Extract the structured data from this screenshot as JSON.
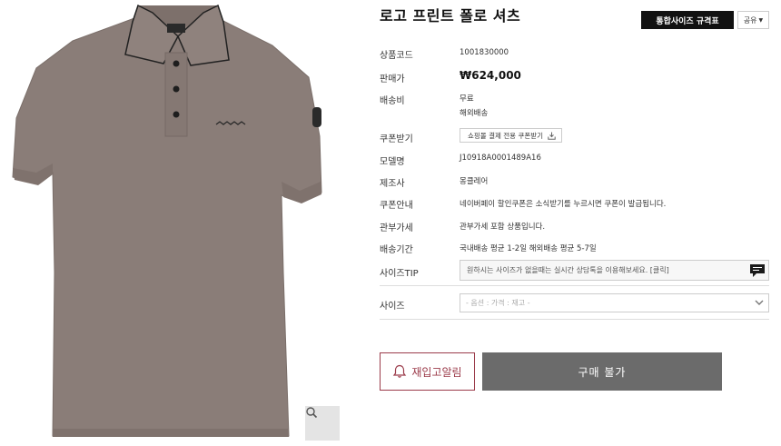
{
  "product": {
    "title": "로고 프린트 폴로 셔츠",
    "image_icon": "polo-shirt-image",
    "shirt_color": "#8a7d78"
  },
  "header": {
    "size_chart_label": "통합사이즈 규격표",
    "share_label": "공유"
  },
  "details": {
    "product_code_label": "상품코드",
    "product_code": "1001830000",
    "price_label": "판매가",
    "price": "₩624,000",
    "shipping_label": "배송비",
    "shipping_fee": "무료",
    "shipping_type": "해외배송",
    "coupon_label": "쿠폰받기",
    "coupon_button": "쇼핑몰 결제 전용 쿠폰받기",
    "model_label": "모델명",
    "model": "J10918A0001489A16",
    "maker_label": "제조사",
    "maker": "몽클레어",
    "coupon_info_label": "쿠폰안내",
    "coupon_info": "네이버페이 할인쿠폰은 소식받기를 누르시면 쿠폰이 발급됩니다.",
    "customs_label": "관부가세",
    "customs": "관부가세 포함 상품입니다.",
    "delivery_label": "배송기간",
    "delivery": "국내배송 평균 1-2일 해외배송 평균 5-7일",
    "size_tip_label": "사이즈TIP",
    "size_tip": "원하시는 사이즈가 없을때는 실시간 상담톡을 이용해보세요. [클릭]",
    "size_label": "사이즈",
    "size_placeholder": "- 옵션 : 가격 : 재고 -"
  },
  "actions": {
    "restock_label": "재입고알림",
    "buy_label": "구매 불가"
  },
  "colors": {
    "accent": "#9b3b4a",
    "buy_button": "#6b6b6b",
    "black_button": "#111111"
  }
}
